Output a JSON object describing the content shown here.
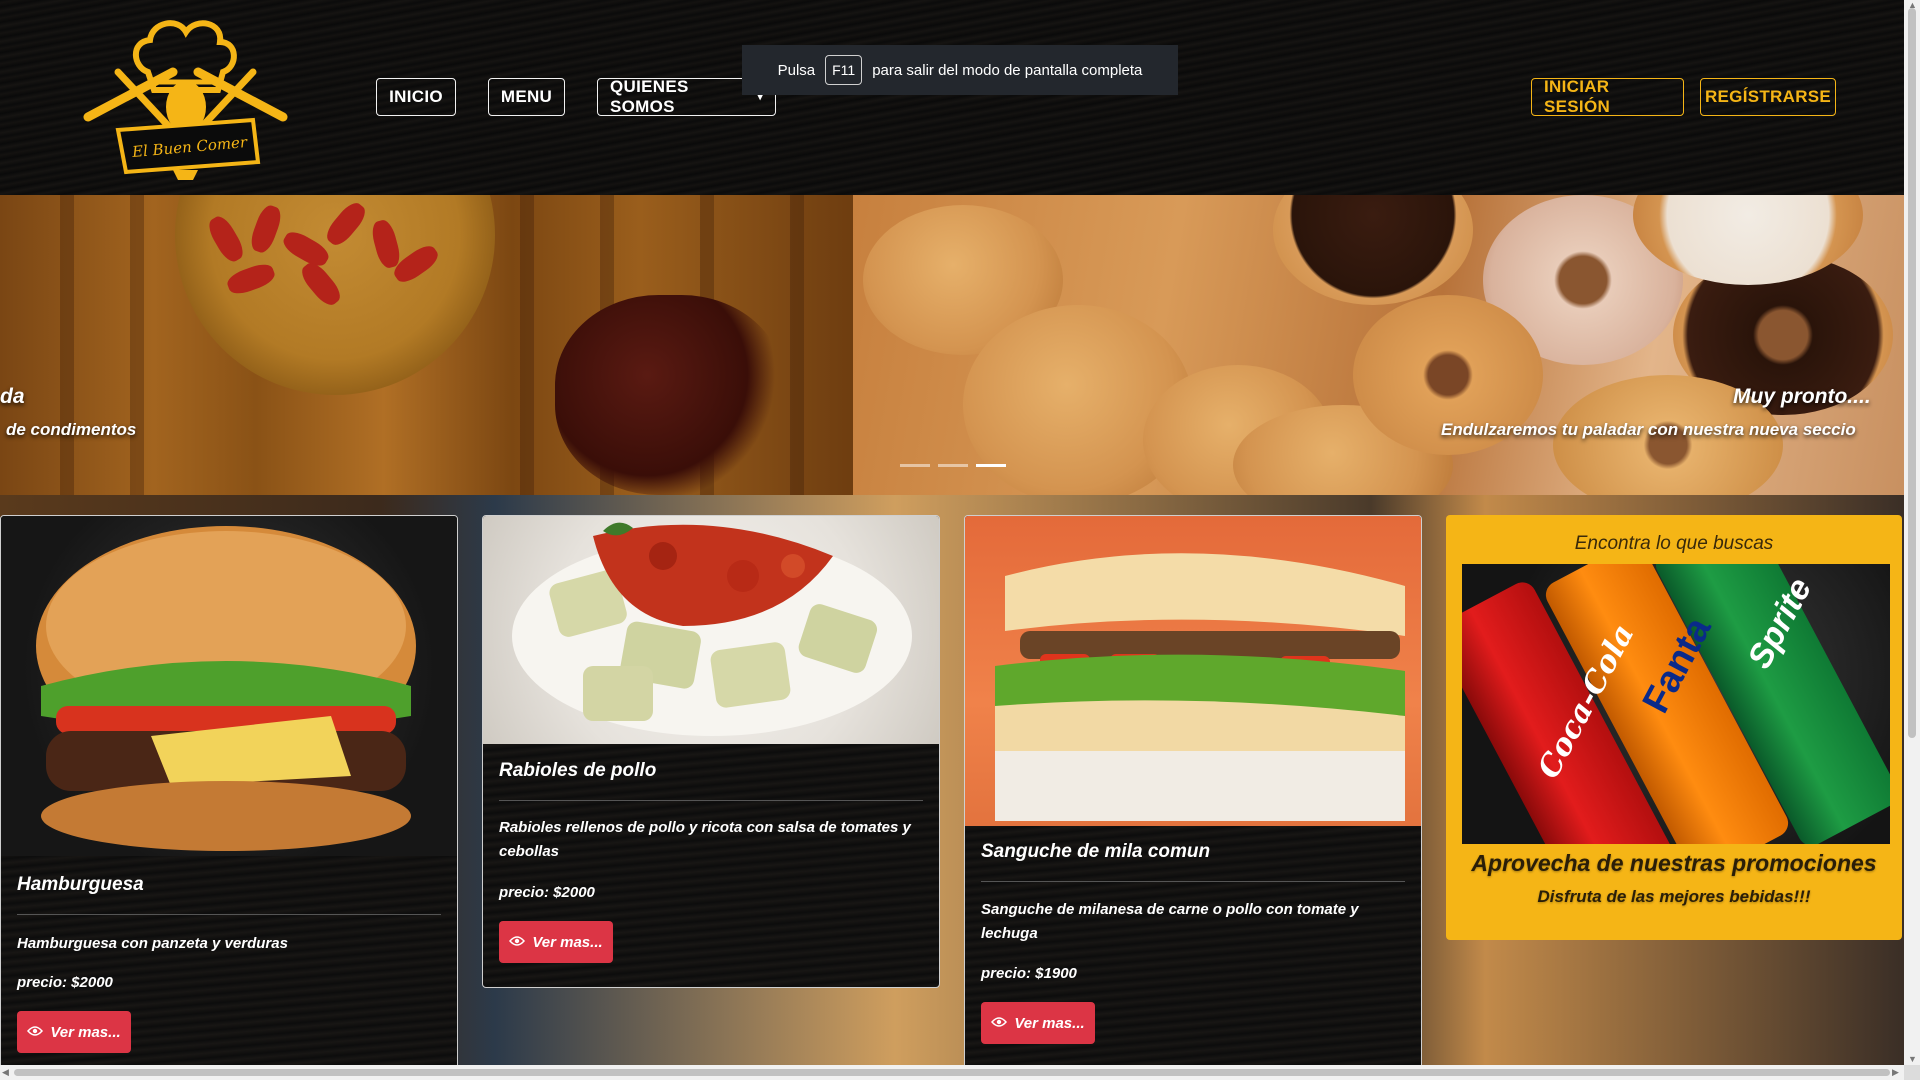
{
  "header": {
    "nav": [
      "INICIO",
      "MENU",
      "QUIENES SOMOS"
    ],
    "login_label": "INICIAR SESIÓN",
    "register_label": "REGÍSTRARSE",
    "logo_text": "El Buen Comer"
  },
  "fullscreen_notice": {
    "pre": "Pulsa",
    "key": "F11",
    "post": "para salir del modo de pantalla completa"
  },
  "carousel": {
    "left_caption_title": "da",
    "left_caption_text": "de condimentos",
    "right_caption_title": "Muy pronto....",
    "right_caption_text": "Endulzaremos tu paladar con nuestra nueva seccio",
    "active_indicator": 3,
    "indicator_count": 3
  },
  "cards": [
    {
      "title": "Hamburguesa",
      "description": "Hamburguesa con panzeta y verduras",
      "price": "precio: $2000",
      "button": "Ver mas..."
    },
    {
      "title": "Rabioles de pollo",
      "description": "Rabioles rellenos de pollo y ricota con salsa de tomates y cebollas",
      "price": "precio: $2000",
      "button": "Ver mas..."
    },
    {
      "title": "Sanguche de mila comun",
      "description": "Sanguche de milanesa de carne o pollo con tomate y lechuga",
      "price": "precio: $1900",
      "button": "Ver mas..."
    }
  ],
  "promo": {
    "heading": "Encontra lo que buscas",
    "title": "Aprovecha de nuestras promociones",
    "subtitle": "Disfruta de las mejores bebidas!!!",
    "can_labels": [
      "Coca-Cola",
      "Fanta",
      "Sprite"
    ]
  },
  "colors": {
    "accent_gold": "#f5b516",
    "button_red": "#dc3545",
    "header_bg": "#0b0b0b"
  }
}
